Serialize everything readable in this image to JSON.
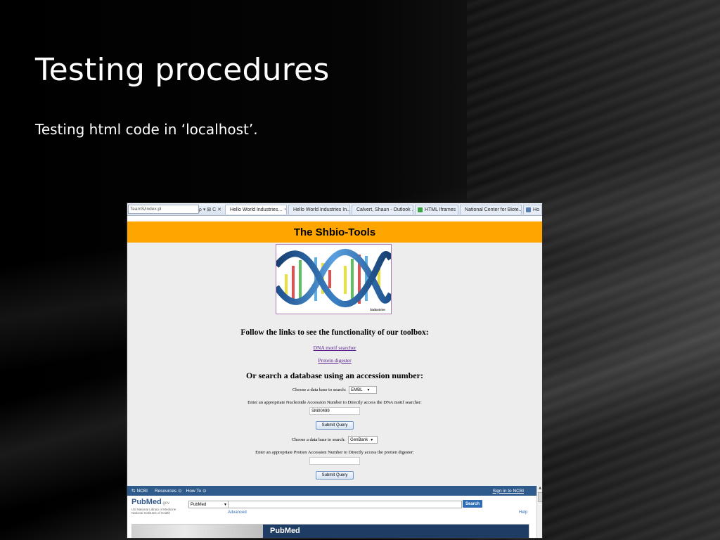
{
  "slide": {
    "title": "Testing procedures",
    "subtitle": "Testing html code in ‘localhost’."
  },
  "browser": {
    "address": "TeamS/index.pl",
    "address_tools": "ρ ▾ ⊠ C ✕",
    "tabs": [
      {
        "label": "Hello World Industries...",
        "active": true,
        "close": "×",
        "icon_color": "#3a7bd5"
      },
      {
        "label": "Hello World Industries In...",
        "active": false,
        "close": "",
        "icon_color": "#3a7bd5"
      },
      {
        "label": "Calvert, Shaun - Outlook ...",
        "active": false,
        "close": "",
        "icon_color": "#f0a020"
      },
      {
        "label": "HTML Iframes",
        "active": false,
        "close": "",
        "icon_color": "#3aa040"
      },
      {
        "label": "National Center for Biote...",
        "active": false,
        "close": "",
        "icon_color": "#5a7fb0"
      },
      {
        "label": "Ho",
        "active": false,
        "close": "",
        "icon_color": "#5a7fb0"
      }
    ]
  },
  "page": {
    "site_title": "The Shbio-Tools",
    "image_caption": "Industries",
    "follow_heading": "Follow the links to see the functionality of our toolbox:",
    "link_dna": "DNA motif searcher",
    "link_protein": "Protein digester",
    "search_heading": "Or search a database using an accession number:",
    "form1": {
      "choose_label": "Choose a data base to search:",
      "db_value": "EMBL",
      "instruction": "Enter an appropriate Nucleotide Accession Number to Directly access the DNA motif searcher:",
      "input_value": "SM00499",
      "submit_label": "Submit Query"
    },
    "form2": {
      "choose_label": "Choose a data base to search:",
      "db_value": "GenBank",
      "instruction": "Enter an appropriate Protien Accession Number to Directly access the protien digester:",
      "input_value": "",
      "submit_label": "Submit Query"
    }
  },
  "ncbi": {
    "logo": "NCBI",
    "resources": "Resources",
    "howto": "How To",
    "signin": "Sign in to NCBI",
    "pubmed_logo": "PubMed",
    "pubmed_gov": ".gov",
    "pubmed_sub1": "US National Library of Medicine",
    "pubmed_sub2": "National Institutes of Health",
    "db_value": "PubMed",
    "search_label": "Search",
    "advanced": "Advanced",
    "help": "Help",
    "banner_title": "PubMed"
  },
  "colors": {
    "header_band": "#ffa500",
    "ncbi_bar": "#2f5b8c",
    "visited_link": "#551a8b"
  }
}
